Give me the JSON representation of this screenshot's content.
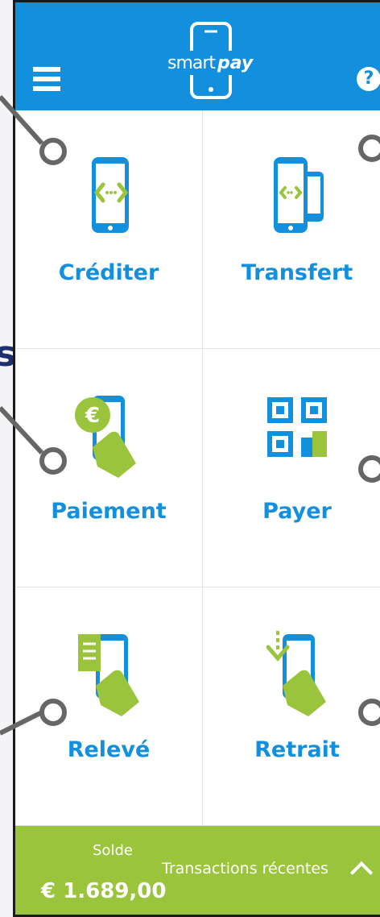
{
  "app": {
    "logo_text_light": "smart",
    "logo_text_bold": "pay"
  },
  "header": {
    "menu_icon": "hamburger-menu-icon",
    "help_icon": "help-icon",
    "help_glyph": "?"
  },
  "left_strip": {
    "glyph": "s"
  },
  "tiles": [
    {
      "label": "Créditer",
      "icon": "phone-code-icon"
    },
    {
      "label": "Transfert",
      "icon": "dual-phone-transfer-icon"
    },
    {
      "label": "Paiement",
      "icon": "euro-coin-hand-phone-icon"
    },
    {
      "label": "Payer",
      "icon": "qr-code-icon"
    },
    {
      "label": "Relevé",
      "icon": "receipt-hand-phone-icon"
    },
    {
      "label": "Retrait",
      "icon": "download-hand-phone-icon"
    }
  ],
  "footer": {
    "solde_label": "Solde",
    "balance": "€ 1.689,00",
    "recent_label": "Transactions récentes"
  },
  "colors": {
    "header_blue": "#1390dd",
    "accent_green": "#9ac43b",
    "text_blue": "#1390dd"
  }
}
